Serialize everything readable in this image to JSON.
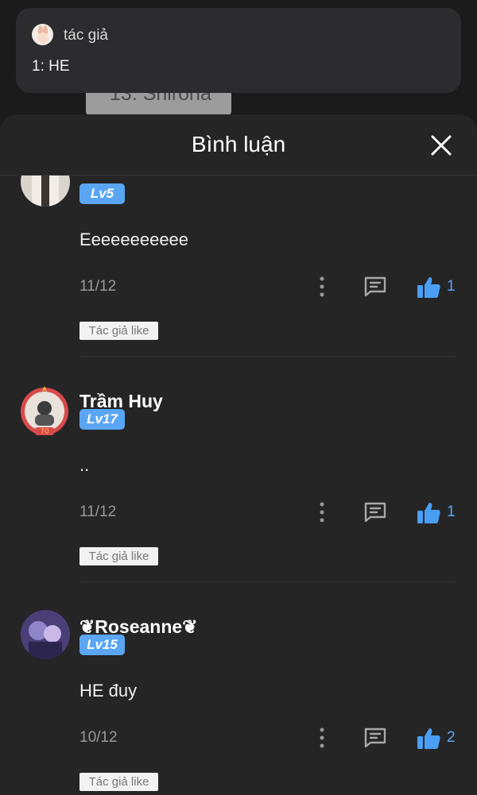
{
  "background": {
    "chip_text": "13. Shirona"
  },
  "author_card": {
    "name": "tác giả",
    "text": "1: HE"
  },
  "sheet": {
    "title": "Bình luận"
  },
  "colors": {
    "accent": "#5aa6f5",
    "sheet_bg": "#252526",
    "card_bg": "#2c2c2e"
  },
  "comments": [
    {
      "name": "",
      "level": "Lv5",
      "text": "Eeeeeeeeeee",
      "date": "11/12",
      "likes": "1",
      "tag": "Tác giả like"
    },
    {
      "name": "Trầm Huy",
      "level": "Lv17",
      "text": "..",
      "date": "11/12",
      "likes": "1",
      "tag": "Tác giả like"
    },
    {
      "name": "❦Roseanne❦",
      "level": "Lv15",
      "text": "HE đuy",
      "date": "10/12",
      "likes": "2",
      "tag": "Tác giả like"
    }
  ]
}
